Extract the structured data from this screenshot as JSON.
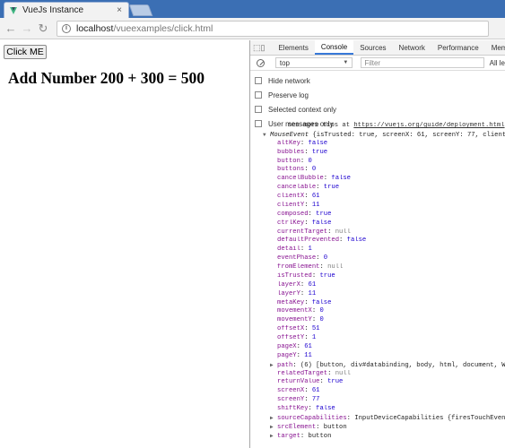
{
  "browser": {
    "tab_title": "VueJs Instance",
    "tab_close": "×",
    "back_glyph": "←",
    "forward_glyph": "→",
    "reload_glyph": "↻",
    "url_host": "localhost",
    "url_path": "/vueexamples/click.html"
  },
  "page": {
    "button_label": "Click ME",
    "heading": "Add Number 200 + 300 = 500"
  },
  "devtools": {
    "inspect_glyph": "⬚",
    "device_glyph": "▯",
    "tabs": [
      "Elements",
      "Console",
      "Sources",
      "Network",
      "Performance",
      "Memo"
    ],
    "context": "top",
    "filter_placeholder": "Filter",
    "levels": "All le",
    "settings": [
      "Hide network",
      "Preserve log",
      "Selected context only",
      "User messages only"
    ],
    "tip_prefix": "see more tips at ",
    "tip_link": "https://vuejs.org/guide/deployment.html",
    "event_header": {
      "name": "MouseEvent",
      "summary": " {isTrusted: true, screenX: 61, screenY: 77, clientX:"
    },
    "props": [
      {
        "key": "altKey",
        "value": "false",
        "kind": "bool",
        "expandable": false
      },
      {
        "key": "bubbles",
        "value": "true",
        "kind": "bool",
        "expandable": false
      },
      {
        "key": "button",
        "value": "0",
        "kind": "num",
        "expandable": false
      },
      {
        "key": "buttons",
        "value": "0",
        "kind": "num",
        "expandable": false
      },
      {
        "key": "cancelBubble",
        "value": "false",
        "kind": "bool",
        "expandable": false
      },
      {
        "key": "cancelable",
        "value": "true",
        "kind": "bool",
        "expandable": false
      },
      {
        "key": "clientX",
        "value": "61",
        "kind": "num",
        "expandable": false
      },
      {
        "key": "clientY",
        "value": "11",
        "kind": "num",
        "expandable": false
      },
      {
        "key": "composed",
        "value": "true",
        "kind": "bool",
        "expandable": false
      },
      {
        "key": "ctrlKey",
        "value": "false",
        "kind": "bool",
        "expandable": false
      },
      {
        "key": "currentTarget",
        "value": "null",
        "kind": "nul",
        "expandable": false
      },
      {
        "key": "defaultPrevented",
        "value": "false",
        "kind": "bool",
        "expandable": false
      },
      {
        "key": "detail",
        "value": "1",
        "kind": "num",
        "expandable": false
      },
      {
        "key": "eventPhase",
        "value": "0",
        "kind": "num",
        "expandable": false
      },
      {
        "key": "fromElement",
        "value": "null",
        "kind": "nul",
        "expandable": false
      },
      {
        "key": "isTrusted",
        "value": "true",
        "kind": "bool",
        "expandable": false
      },
      {
        "key": "layerX",
        "value": "61",
        "kind": "num",
        "expandable": false
      },
      {
        "key": "layerY",
        "value": "11",
        "kind": "num",
        "expandable": false
      },
      {
        "key": "metaKey",
        "value": "false",
        "kind": "bool",
        "expandable": false
      },
      {
        "key": "movementX",
        "value": "0",
        "kind": "num",
        "expandable": false
      },
      {
        "key": "movementY",
        "value": "0",
        "kind": "num",
        "expandable": false
      },
      {
        "key": "offsetX",
        "value": "51",
        "kind": "num",
        "expandable": false
      },
      {
        "key": "offsetY",
        "value": "1",
        "kind": "num",
        "expandable": false
      },
      {
        "key": "pageX",
        "value": "61",
        "kind": "num",
        "expandable": false
      },
      {
        "key": "pageY",
        "value": "11",
        "kind": "num",
        "expandable": false
      },
      {
        "key": "path",
        "value": "(6) [button, div#databinding, body, html, document, Window]",
        "kind": "obj",
        "expandable": true
      },
      {
        "key": "relatedTarget",
        "value": "null",
        "kind": "nul",
        "expandable": false
      },
      {
        "key": "returnValue",
        "value": "true",
        "kind": "bool",
        "expandable": false
      },
      {
        "key": "screenX",
        "value": "61",
        "kind": "num",
        "expandable": false
      },
      {
        "key": "screenY",
        "value": "77",
        "kind": "num",
        "expandable": false
      },
      {
        "key": "shiftKey",
        "value": "false",
        "kind": "bool",
        "expandable": false
      },
      {
        "key": "sourceCapabilities",
        "value": "InputDeviceCapabilities {firesTouchEvents: false}",
        "kind": "obj",
        "expandable": true
      },
      {
        "key": "srcElement",
        "value": "button",
        "kind": "obj",
        "expandable": true
      },
      {
        "key": "target",
        "value": "button",
        "kind": "obj",
        "expandable": true
      }
    ]
  }
}
